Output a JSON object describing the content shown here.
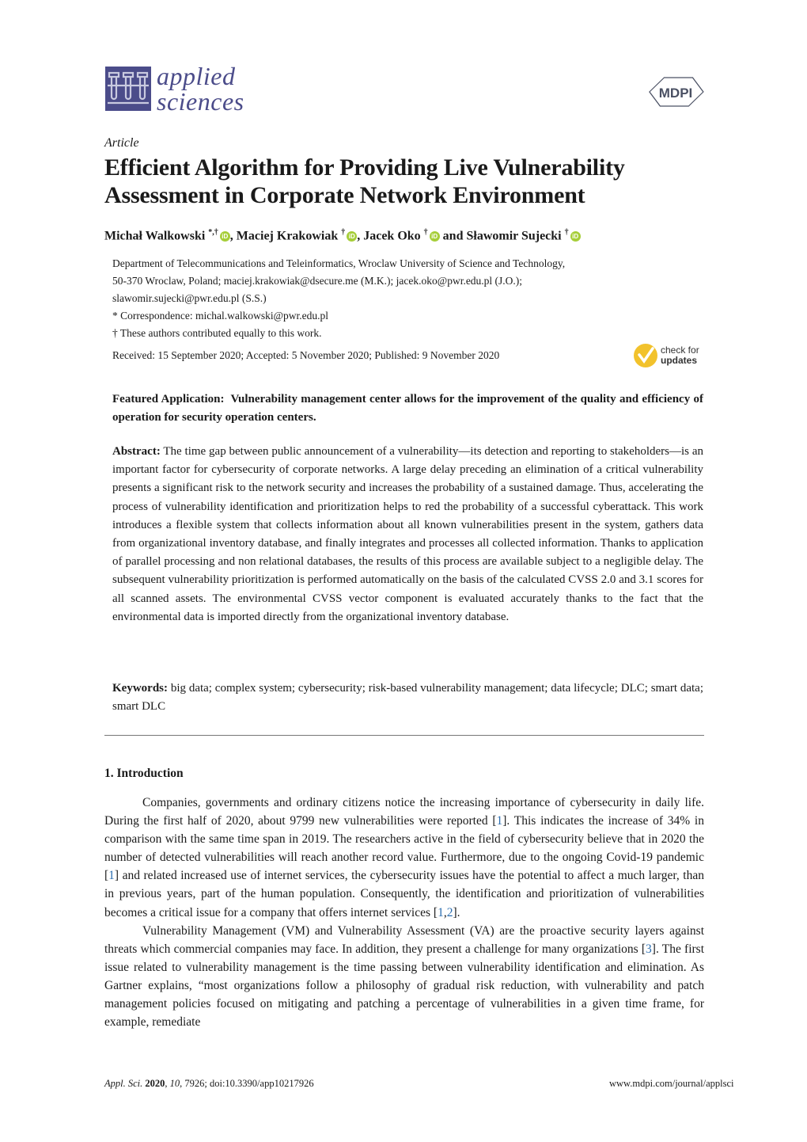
{
  "header": {
    "journal_line1": "applied",
    "journal_line2": "sciences",
    "publisher": "MDPI"
  },
  "article_type": "Article",
  "title": "Efficient Algorithm for Providing Live Vulnerability Assessment in Corporate Network Environment",
  "authors": [
    {
      "name": "Michał Walkowski",
      "marks": "*,†"
    },
    {
      "name": "Maciej Krakowiak",
      "marks": "†"
    },
    {
      "name": "Jacek Oko",
      "marks": "†"
    },
    {
      "name": "Sławomir Sujecki",
      "marks": "†"
    }
  ],
  "authors_sep": [
    ", ",
    ", ",
    " and "
  ],
  "affiliation": [
    "Department of Telecommunications and Teleinformatics, Wroclaw University of Science and Technology,",
    "50-370 Wroclaw, Poland; maciej.krakowiak@dsecure.me (M.K.); jacek.oko@pwr.edu.pl (J.O.);",
    "slawomir.sujecki@pwr.edu.pl (S.S.)",
    "*  Correspondence: michal.walkowski@pwr.edu.pl",
    "†  These authors contributed equally to this work."
  ],
  "dates": "Received: 15 September 2020; Accepted: 5 November 2020; Published: 9 November 2020",
  "check_updates": {
    "line1": "check for",
    "line2": "updates",
    "color": "#f2c22c"
  },
  "featured": {
    "label": "Featured Application:",
    "text": "Vulnerability management center allows for the improvement of the quality and efficiency of operation for security operation centers."
  },
  "abstract": {
    "label": "Abstract:",
    "text": "The time gap between public announcement of a vulnerability—its detection and reporting to stakeholders—is an important factor for cybersecurity of corporate networks. A large delay preceding an elimination of a critical vulnerability presents a significant risk to the network security and increases the probability of a sustained damage. Thus, accelerating the process of vulnerability identification and prioritization helps to red the probability of a successful cyberattack. This work introduces a flexible system that collects information about all known vulnerabilities present in the system, gathers data from organizational inventory database, and finally integrates and processes all collected information. Thanks to application of parallel processing and non relational databases, the results of this process are available subject to a negligible delay. The subsequent vulnerability prioritization is performed automatically on the basis of the calculated CVSS 2.0 and 3.1 scores for all scanned assets. The environmental CVSS vector component is evaluated accurately thanks to the fact that the environmental data is imported directly from the organizational inventory database."
  },
  "keywords": {
    "label": "Keywords:",
    "text": "big data; complex system; cybersecurity; risk-based vulnerability management; data lifecycle; DLC; smart data; smart DLC"
  },
  "section": "1. Introduction",
  "paragraphs": [
    {
      "parts": [
        "Companies, governments and ordinary citizens notice the increasing importance of cybersecurity in daily life.  During the first half of 2020, about 9799 new vulnerabilities were reported [",
        "1",
        "]. This indicates the increase of 34% in comparison with the same time span in 2019. The researchers active in the field of cybersecurity believe that in 2020 the number of detected vulnerabilities will reach another record value. Furthermore, due to the ongoing Covid-19 pandemic [",
        "1",
        "] and related increased use of internet services, the cybersecurity issues have the potential to affect a much larger, than in previous years, part of the human population. Consequently, the identification and prioritization of vulnerabilities becomes a critical issue for a company that offers internet services [",
        "1",
        ",",
        "2",
        "]."
      ]
    },
    {
      "parts": [
        "Vulnerability Management (VM) and Vulnerability Assessment (VA) are the proactive security layers against threats which commercial companies may face. In addition, they present a challenge for many organizations [",
        "3",
        "]. The first issue related to vulnerability management is the time passing between vulnerability identification and elimination. As Gartner explains, “most organizations follow a philosophy of gradual risk reduction, with vulnerability and patch management policies focused on mitigating and patching a percentage of vulnerabilities in a given time frame, for example, remediate"
      ]
    }
  ],
  "footer": {
    "journal_abbr": "Appl. Sci.",
    "year": "2020",
    "volume": "10",
    "rest": ", 7926; doi:10.3390/app10217926",
    "url": "www.mdpi.com/journal/applsci"
  },
  "colors": {
    "brand": "#4b4c8a",
    "citation": "#2a6db0",
    "orcid": "#a6ce39"
  }
}
